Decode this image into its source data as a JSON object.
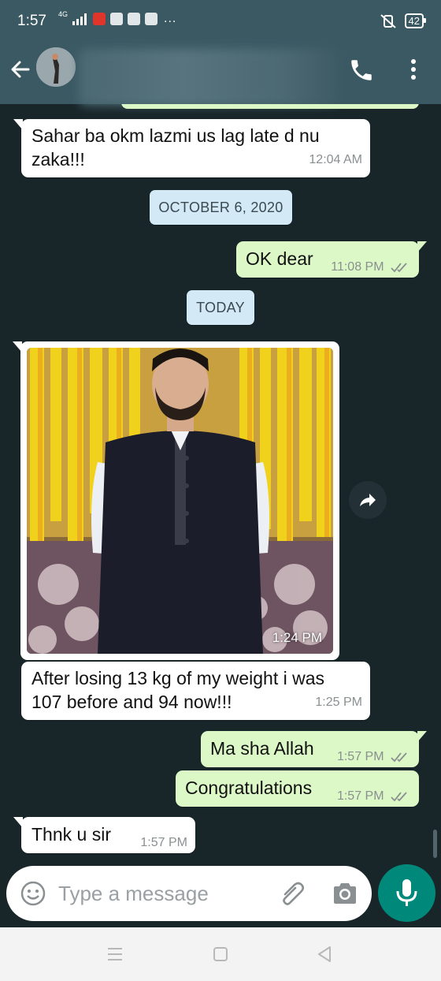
{
  "status_bar": {
    "time": "1:57",
    "network": "4G",
    "battery": "42",
    "overflow": "..."
  },
  "header": {
    "back_icon": "arrow-left-icon",
    "call_icon": "phone-icon",
    "menu_icon": "more-vert-icon"
  },
  "messages": [
    {
      "dir": "in",
      "text_lines": [
        "Sahar ba okm lazmi us lag late d nu",
        "zaka!!!"
      ],
      "time": "12:04 AM"
    },
    {
      "type": "date",
      "text": "OCTOBER 6, 2020"
    },
    {
      "dir": "out",
      "text": "OK dear",
      "time": "11:08 PM"
    },
    {
      "type": "date",
      "text": "TODAY"
    },
    {
      "dir": "in",
      "type": "image",
      "time": "1:24 PM"
    },
    {
      "dir": "in",
      "text_lines": [
        "After losing 13 kg of my weight i was",
        "107 before and 94 now!!!"
      ],
      "time": "1:25 PM"
    },
    {
      "dir": "out",
      "text": "Ma sha Allah",
      "time": "1:57 PM"
    },
    {
      "dir": "out",
      "text": "Congratulations",
      "time": "1:57 PM"
    },
    {
      "dir": "in",
      "text": "Thnk u sir",
      "time": "1:57 PM"
    }
  ],
  "composer": {
    "placeholder": "Type a message",
    "emoji_icon": "emoji-icon",
    "attach_icon": "paperclip-icon",
    "camera_icon": "camera-icon",
    "mic_icon": "mic-icon"
  },
  "colors": {
    "header": "#3b5963",
    "background": "#18262a",
    "outgoing": "#dcf8c6",
    "incoming": "#ffffff",
    "date_pill": "#d3e9f6",
    "accent": "#00897b",
    "read_ticks": "#8a8f91"
  }
}
